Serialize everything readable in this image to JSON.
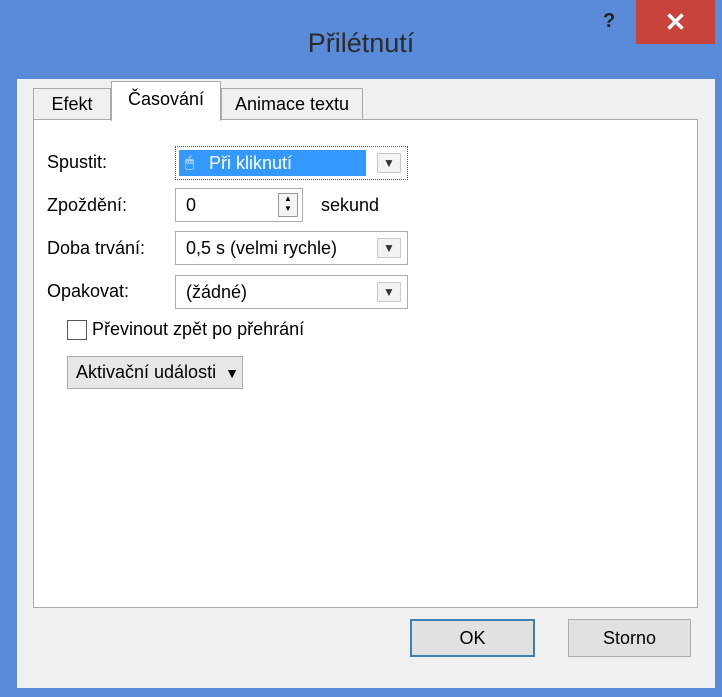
{
  "window": {
    "title": "Přilétnutí",
    "help": "?",
    "close": "✕"
  },
  "tabs": [
    {
      "label": "Efekt",
      "active": false
    },
    {
      "label": "Časování",
      "active": true
    },
    {
      "label": "Animace textu",
      "active": false
    }
  ],
  "form": {
    "start_label": "Spustit:",
    "start_value": "Při kliknutí",
    "delay_label": "Zpoždění:",
    "delay_value": "0",
    "delay_unit": "sekund",
    "duration_label": "Doba trvání:",
    "duration_value": "0,5 s (velmi rychle)",
    "repeat_label": "Opakovat:",
    "repeat_value": "(žádné)",
    "rewind_label": "Převinout zpět po přehrání",
    "rewind_checked": false,
    "triggers_label": "Aktivační události",
    "triggers_icon": "double-chevron-down-icon"
  },
  "buttons": {
    "ok": "OK",
    "cancel": "Storno"
  },
  "colors": {
    "titlebar": "#5a8bd8",
    "close": "#c7433b",
    "selection": "#3399ff"
  }
}
